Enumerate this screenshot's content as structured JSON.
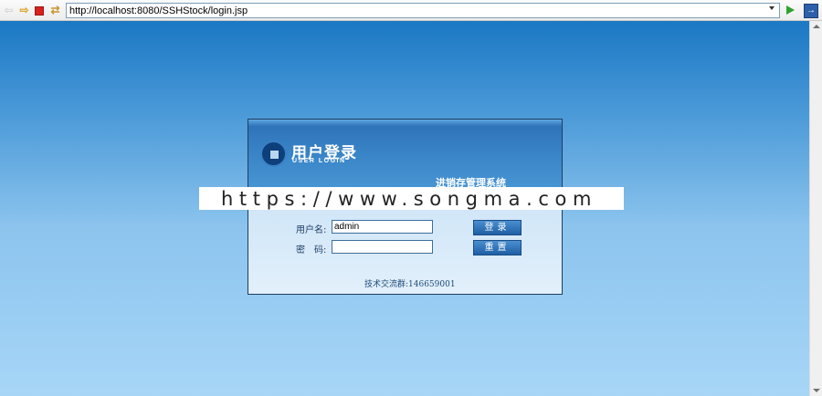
{
  "browser": {
    "address": "http://localhost:8080/SSHStock/login.jsp",
    "icons": [
      "back-icon",
      "forward-icon",
      "stop-icon",
      "refresh-icon",
      "dropdown-icon",
      "go-icon",
      "external-icon"
    ]
  },
  "login": {
    "title_cn": "用户登录",
    "title_en": "USER LOGIN",
    "system_name": "进销存管理系统",
    "username_label": "用户名:",
    "password_label": "密　码:",
    "username_value": "admin",
    "password_value": "",
    "login_button": "登录",
    "reset_button": "重置",
    "contact": "技术交流群:146659001"
  },
  "watermark": "https://www.songma.com",
  "colors": {
    "background_top": "#1b78c4",
    "background_bottom": "#a7d6f7",
    "panel_border": "#1e3e63",
    "button": "#2a6fb5"
  }
}
